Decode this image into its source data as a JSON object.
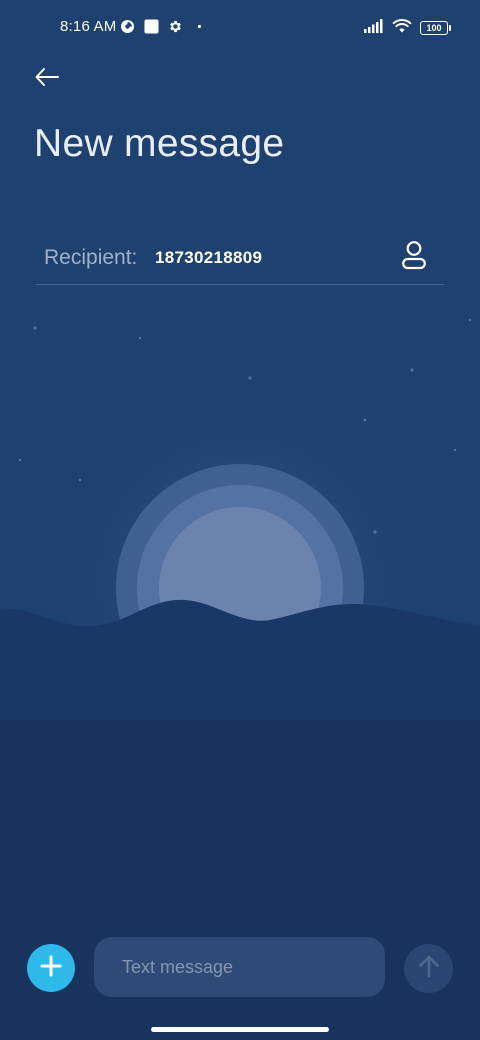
{
  "status_bar": {
    "time": "8:16 AM",
    "battery": "100",
    "icons": [
      "data-saver-icon",
      "square-notification-icon",
      "settings-gear-icon",
      "dot-icon",
      "signal-bars-icon",
      "wifi-icon",
      "battery-icon"
    ]
  },
  "header": {
    "back_icon": "arrow-left-icon",
    "title": "New message"
  },
  "recipient": {
    "label": "Recipient:",
    "value": "18730218809",
    "contact_icon": "person-icon"
  },
  "composer": {
    "add_icon": "plus-icon",
    "placeholder": "Text message",
    "value": "",
    "send_icon": "arrow-up-icon"
  },
  "colors": {
    "background": "#1f416f",
    "accent": "#2fb8ea",
    "input_background": "#2e4a77",
    "send_background": "#2a4672"
  }
}
